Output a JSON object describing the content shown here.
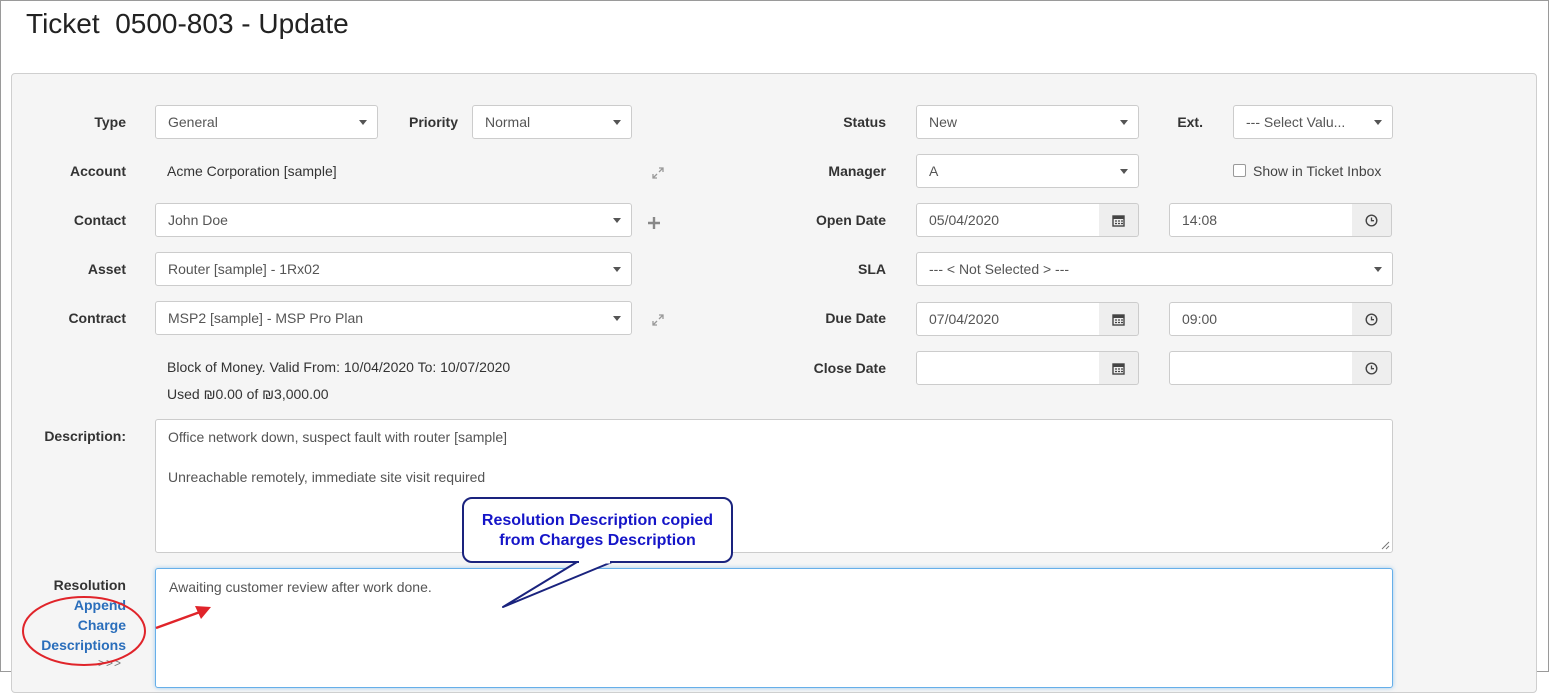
{
  "page": {
    "title": "Ticket  0500-803 - Update"
  },
  "labels": {
    "type": "Type",
    "priority": "Priority",
    "status": "Status",
    "ext": "Ext.",
    "account": "Account",
    "manager": "Manager",
    "contact": "Contact",
    "open_date": "Open Date",
    "asset": "Asset",
    "sla": "SLA",
    "contract": "Contract",
    "due_date": "Due Date",
    "close_date": "Close Date",
    "description": "Description:",
    "resolution": "Resolution"
  },
  "fields": {
    "type": "General",
    "priority": "Normal",
    "status": "New",
    "ext": "--- Select Valu...",
    "account": "Acme Corporation [sample]",
    "manager": "A",
    "show_in_inbox": "Show in Ticket Inbox",
    "contact": "John Doe",
    "open_date": "05/04/2020",
    "open_time": "14:08",
    "asset": "Router [sample] - 1Rx02",
    "sla": "--- < Not Selected > ---",
    "contract": "MSP2 [sample] - MSP Pro Plan",
    "due_date": "07/04/2020",
    "due_time": "09:00",
    "close_date": "",
    "close_time": "",
    "contract_info": "Block of Money. Valid From: 10/04/2020 To: 10/07/2020",
    "contract_used": "Used ₪0.00 of ₪3,000.00",
    "description_lines": [
      "Office network down, suspect fault with router [sample]",
      "",
      "Unreachable remotely, immediate site visit required"
    ],
    "resolution": "Awaiting customer review after work done."
  },
  "links": {
    "append_charge_lines": [
      "Append",
      "Charge",
      "Descriptions"
    ],
    "more": ">>>"
  },
  "callout": {
    "lines": [
      "Resolution Description copied",
      "from Charges Description"
    ]
  },
  "icons": {
    "calendar": "calendar-icon",
    "clock": "clock-icon",
    "plus": "plus-icon",
    "expand": "expand-icon",
    "dropdown": "chevron-down-icon"
  },
  "colors": {
    "callout_text": "#1515c8",
    "callout_border": "#1a237e",
    "highlight_red": "#e0242a",
    "link_blue": "#2a6ebb"
  }
}
